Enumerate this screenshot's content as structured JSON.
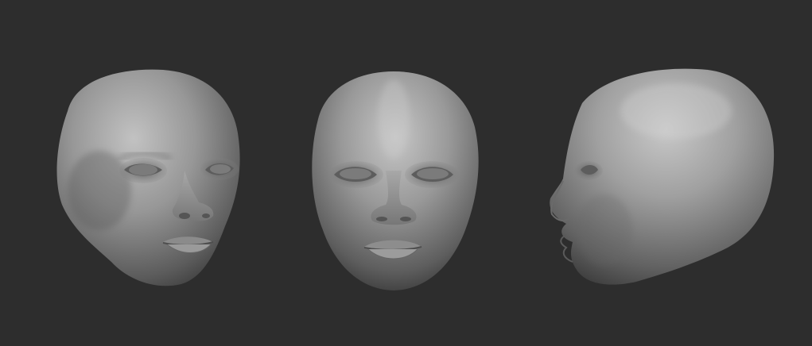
{
  "scene": {
    "background_color": "#2d2d2d",
    "material_color": "#9a9a9a",
    "views": [
      {
        "name": "three-quarter"
      },
      {
        "name": "front"
      },
      {
        "name": "side"
      }
    ]
  }
}
